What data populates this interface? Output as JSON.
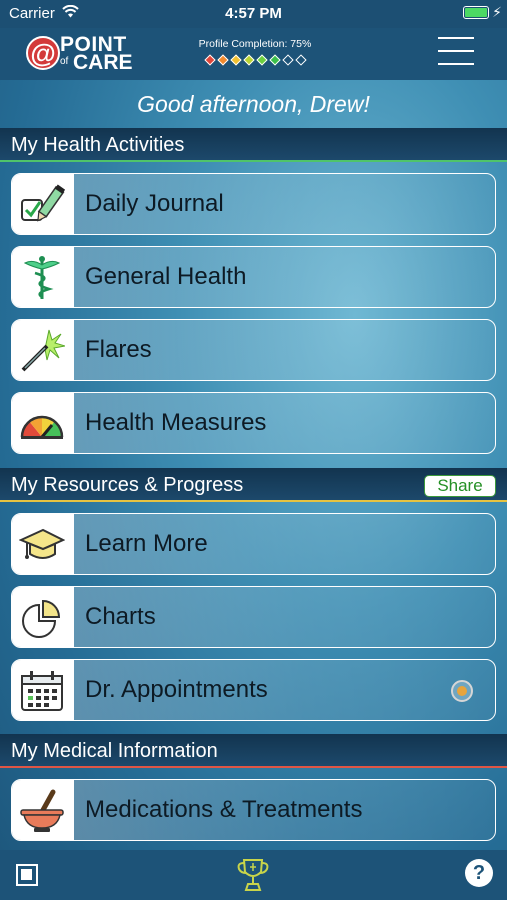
{
  "status_bar": {
    "carrier": "Carrier",
    "time": "4:57 PM",
    "icons": [
      "wifi-icon",
      "battery-icon",
      "charging-bolt-icon"
    ]
  },
  "header": {
    "logo": {
      "at_symbol": "@",
      "word1": "POINT",
      "word_small": "of",
      "word2": "CARE"
    },
    "profile_completion": "Profile Completion: 75%",
    "progress_diamonds": [
      "#e0463a",
      "#f08a2e",
      "#f1c232",
      "#b9d334",
      "#6bcf3f",
      "#3bbf4a",
      "empty",
      "empty"
    ],
    "menu_icon": "hamburger-menu-icon"
  },
  "greeting": "Good afternoon, Drew!",
  "sections": {
    "health_activities": {
      "title": "My Health Activities",
      "accent": "#4fc46a",
      "items": [
        {
          "label": "Daily Journal",
          "icon": "journal-pencil-icon"
        },
        {
          "label": "General Health",
          "icon": "caduceus-icon"
        },
        {
          "label": "Flares",
          "icon": "flare-spark-icon"
        },
        {
          "label": "Health Measures",
          "icon": "gauge-icon"
        }
      ]
    },
    "resources_progress": {
      "title": "My Resources & Progress",
      "accent": "#e6c341",
      "share_label": "Share",
      "items": [
        {
          "label": "Learn More",
          "icon": "graduation-cap-icon"
        },
        {
          "label": "Charts",
          "icon": "pie-chart-icon"
        },
        {
          "label": "Dr. Appointments",
          "icon": "calendar-icon",
          "indicator": "radio-selected"
        }
      ]
    },
    "medical_information": {
      "title": "My Medical Information",
      "accent": "#e05545",
      "items": [
        {
          "label": "Medications & Treatments",
          "icon": "mortar-pestle-icon"
        }
      ]
    }
  },
  "bottom_bar": {
    "left_icon": "square-stop-icon",
    "center_icon": "trophy-icon",
    "help_label": "?"
  },
  "colors": {
    "header_bg": "#1d5378",
    "section_bg": "#12344f",
    "card_text": "#0d1a24",
    "share_green": "#259025"
  }
}
